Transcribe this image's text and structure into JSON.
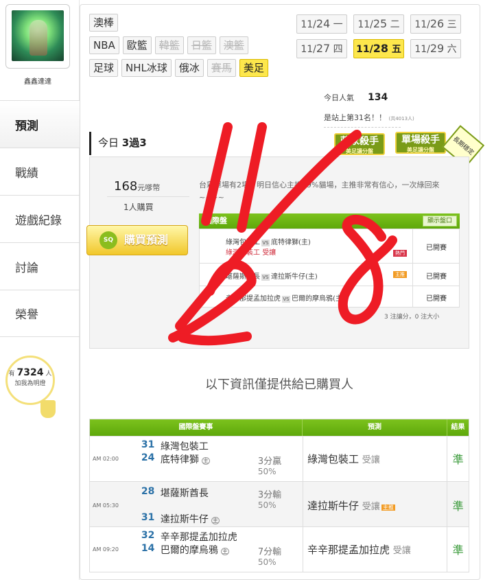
{
  "user": {
    "name": "鑫鑫達達"
  },
  "sidebar": {
    "items": [
      {
        "label": "預測",
        "active": true
      },
      {
        "label": "戰績",
        "active": false
      },
      {
        "label": "遊戲紀錄",
        "active": false
      },
      {
        "label": "討論",
        "active": false
      },
      {
        "label": "榮譽",
        "active": false
      }
    ],
    "fans_prefix": "有",
    "fans_count": "7324",
    "fans_suffix": "人",
    "fans_cta": "加我為明燈"
  },
  "league_tags": [
    [
      {
        "label": "澳棒",
        "state": "normal"
      }
    ],
    [
      {
        "label": "NBA",
        "state": "normal"
      },
      {
        "label": "歐籃",
        "state": "normal"
      },
      {
        "label": "韓籃",
        "state": "disabled"
      },
      {
        "label": "日籃",
        "state": "disabled"
      },
      {
        "label": "澳籃",
        "state": "disabled"
      }
    ],
    [
      {
        "label": "足球",
        "state": "normal"
      },
      {
        "label": "NHL冰球",
        "state": "normal"
      },
      {
        "label": "俄冰",
        "state": "normal"
      },
      {
        "label": "賽馬",
        "state": "disabled"
      },
      {
        "label": "美足",
        "state": "selected"
      }
    ]
  ],
  "dates": [
    [
      {
        "md": "11/",
        "d": "24",
        "w": "一"
      },
      {
        "md": "11/",
        "d": "25",
        "w": "二"
      },
      {
        "md": "11/",
        "d": "26",
        "w": "三"
      }
    ],
    [
      {
        "md": "11/",
        "d": "27",
        "w": "四"
      },
      {
        "md": "11/",
        "d": "28",
        "w": "五",
        "selected": true
      },
      {
        "md": "11/",
        "d": "29",
        "w": "六"
      }
    ]
  ],
  "stats": {
    "pop_label": "今日人氣",
    "pop_value": "134",
    "rank_text": "是站上第31名！！",
    "rank_total": "(共4013人)"
  },
  "badges": {
    "b1": "莊家殺手",
    "b1_sub": "美足讓分盤",
    "b2": "單場殺手",
    "b2_sub": "美足讓分盤",
    "b3": "長期穩定"
  },
  "today": {
    "prefix": "今日",
    "record": "3過3"
  },
  "purchase": {
    "price": "168",
    "unit": "元嗲幣",
    "buyers": "1人購買",
    "button": "購買預測",
    "icon_text": "SQ",
    "description": "台彩單場有2場，明日信心主推99%貓場，主推非常有信心，一次綠回來~~~~"
  },
  "mini_table": {
    "header": "國際盤",
    "toggle": "顯示盤口",
    "vs": "VS",
    "rows": [
      {
        "away": "綠灣包裝工",
        "home": "底特律獅(主)",
        "pick": "綠灣包裝工",
        "pick_type": "受讓",
        "tag": "熱門",
        "status": "已開賽"
      },
      {
        "away": "堪薩斯酋長",
        "home": "達拉斯牛仔(主)",
        "tag": "主推",
        "status": "已開賽"
      },
      {
        "away": "辛辛那提孟加拉虎",
        "home": "巴爾的摩烏鴉(主)",
        "status": "已開賽"
      }
    ],
    "footer": "3 注讓分，0 注大小"
  },
  "notice": "以下資訊僅提供給已購買人",
  "big_table": {
    "headers": {
      "game": "國際盤賽事",
      "pick": "預測",
      "result": "結果"
    },
    "host_mark": "主",
    "rows": [
      {
        "time": "AM 02:00",
        "s1": "31",
        "t1": "綠灣包裝工",
        "s2": "24",
        "t2": "底特律獅",
        "t2_host": true,
        "line": "3分贏",
        "pct": "50%",
        "pick": "綠灣包裝工",
        "pick_type": "受讓",
        "result": "準"
      },
      {
        "time": "AM 05:30",
        "s1": "28",
        "t1": "堪薩斯酋長",
        "s2": "31",
        "t2": "達拉斯牛仔",
        "t2_host": true,
        "line": "3分輸",
        "pct": "50%",
        "pick": "達拉斯牛仔",
        "pick_type": "受讓",
        "pick_tag": "主推",
        "result": "準"
      },
      {
        "time": "AM 09:20",
        "s1": "32",
        "t1": "辛辛那提孟加拉虎",
        "s2": "14",
        "t2": "巴爾的摩烏鴉",
        "t2_host": true,
        "line": "7分輸",
        "pct": "50%",
        "pick": "辛辛那提孟加拉虎",
        "pick_type": "受讓",
        "result": "準"
      }
    ]
  },
  "overlay": {
    "handwriting": "11/28",
    "color": "#ee1c25"
  }
}
